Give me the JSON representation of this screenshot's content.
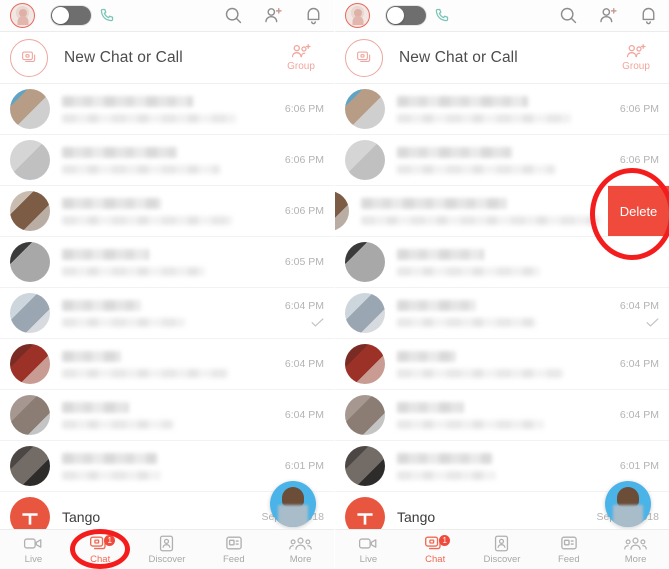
{
  "app": {
    "name": "Tango",
    "accent_color": "#ef6a55",
    "delete_color": "#ef4a3c",
    "annotation_color": "#f41d1d",
    "toggle_color": "#6e6e6e",
    "phone_icon_color": "#79c4b6",
    "bubble_color": "#4ab3e8"
  },
  "topbar": {
    "avatar_name": "profile-avatar",
    "toggle_state": "off",
    "icons": {
      "call": "phone-icon",
      "search": "search-icon",
      "add_contact": "add-contact-icon",
      "notifications": "bell-icon"
    }
  },
  "newchat": {
    "label": "New Chat or Call",
    "icon": "new-chat-icon",
    "group_label": "Group",
    "group_icon": "add-group-icon"
  },
  "list": {
    "rows": [
      {
        "time": "6:06 PM",
        "avatar": "#8fa6b8",
        "read": false,
        "name": "",
        "message": ""
      },
      {
        "time": "6:06 PM",
        "avatar": "#c9c9c9",
        "read": false,
        "name": "",
        "message": ""
      },
      {
        "time": "6:06 PM",
        "avatar": "#8d7361",
        "read": false,
        "name": "",
        "message": ""
      },
      {
        "time": "6:05 PM",
        "avatar": "#6d6d6d",
        "read": false,
        "name": "",
        "message": ""
      },
      {
        "time": "6:04 PM",
        "avatar": "#b9c3cc",
        "read": true,
        "name": "",
        "message": ""
      },
      {
        "time": "6:04 PM",
        "avatar": "#8f2f28",
        "read": false,
        "name": "",
        "message": ""
      },
      {
        "time": "6:04 PM",
        "avatar": "#9a8c85",
        "read": false,
        "name": "",
        "message": ""
      },
      {
        "time": "6:01 PM",
        "avatar": "#55504e",
        "read": false,
        "name": "",
        "message": ""
      }
    ],
    "tango_row": {
      "name": "Tango",
      "time": "Sep 18, 2018",
      "avatar_letter": "T"
    },
    "swipe": {
      "delete_label": "Delete",
      "swiped_row_index": 2
    }
  },
  "nav": {
    "items": [
      {
        "label": "Live",
        "icon": "video-camera-icon",
        "active": false,
        "badge": ""
      },
      {
        "label": "Chat",
        "icon": "chat-bubble-icon",
        "active": true,
        "badge": "1"
      },
      {
        "label": "Discover",
        "icon": "discover-icon",
        "active": false,
        "badge": ""
      },
      {
        "label": "Feed",
        "icon": "feed-icon",
        "active": false,
        "badge": ""
      },
      {
        "label": "More",
        "icon": "more-people-icon",
        "active": false,
        "badge": ""
      }
    ]
  },
  "annotations": [
    {
      "name": "chat-tab-highlight",
      "panel": "left",
      "shape": "ellipse"
    },
    {
      "name": "delete-button-highlight",
      "panel": "right",
      "shape": "ellipse"
    }
  ]
}
